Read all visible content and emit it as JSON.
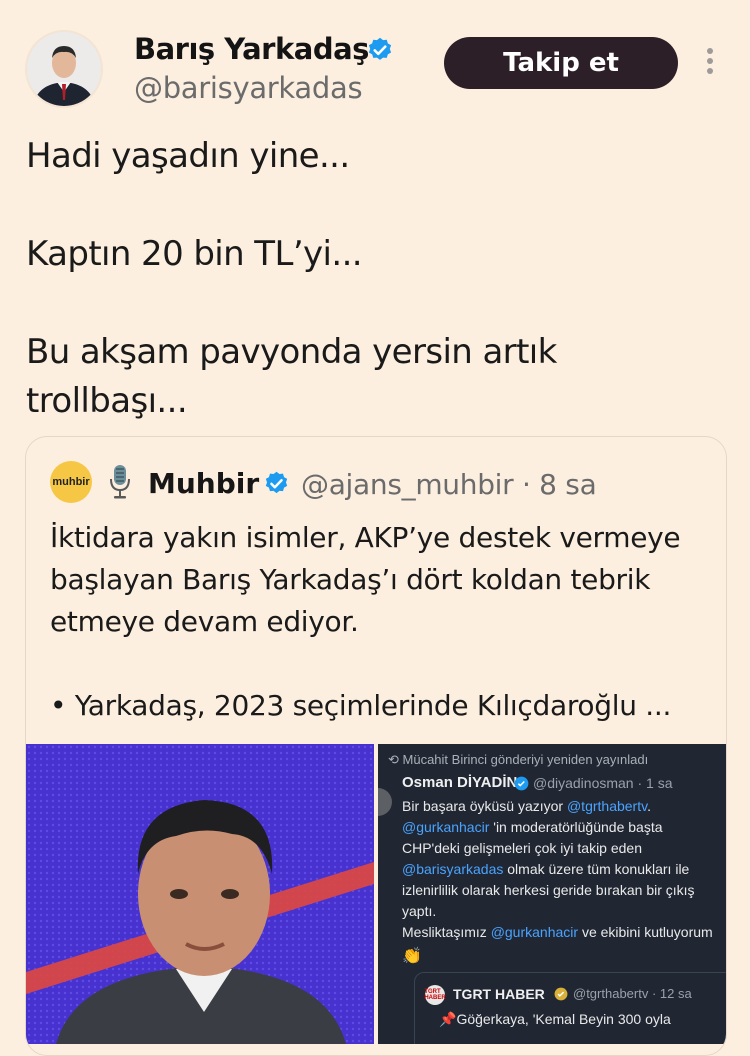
{
  "author": {
    "name": "Barış Yarkadaş",
    "handle": "@barisyarkadas",
    "verified": true
  },
  "follow_button": {
    "label": "Takip et"
  },
  "tweet": {
    "paragraphs": [
      "Hadi yaşadın yine...",
      "Kaptın 20 bin TL’yi...",
      "Bu akşam pavyonda yersin artık",
      "trollbaşı..."
    ]
  },
  "quote": {
    "logo_text": "muhbir",
    "name": "Muhbir",
    "handle_time": "@ajans_muhbir · 8 sa",
    "text_lines": [
      "İktidara yakın isimler, AKP’ye destek vermeye",
      "başlayan Barış Yarkadaş’ı dört koldan tebrik",
      "etmeye devam ediyor."
    ],
    "bullet": "• Yarkadaş, 2023 seçimlerinde Kılıçdaroğlu ..."
  },
  "embedded_screenshot": {
    "retweet_line": "Mücahit Birinci gönderiyi yeniden yayınladı",
    "name": "Osman DİYADİN",
    "handle_time": "@diyadinosman · 1 sa",
    "lines": [
      {
        "pre": "Bir başara öyküsü yazıyor ",
        "link": "@tgrthabertv",
        "post": "."
      },
      {
        "pre": "",
        "link": "@gurkanhacir",
        "post": " 'in moderatörlüğünde başta"
      },
      {
        "pre": "CHP'deki  gelişmeleri çok iyi takip eden",
        "link": "",
        "post": ""
      },
      {
        "pre": "",
        "link": "@barisyarkadas",
        "post": "  olmak üzere tüm konukları ile"
      },
      {
        "pre": "izlenirlilik olarak herkesi geride bırakan bir çıkış",
        "link": "",
        "post": ""
      },
      {
        "pre": "yaptı.",
        "link": "",
        "post": ""
      },
      {
        "pre": "Mesliktaşımız ",
        "link": "@gurkanhacir",
        "post": " ve ekibini kutluyorum"
      }
    ],
    "clap": "👏",
    "quoted_logo": "TGRT HABER",
    "quoted_name": "TGRT HABER",
    "quoted_handle_time": "@tgrthabertv · 12 sa",
    "quoted_body": "Göğerkaya, 'Kemal Beyin 300 oyla"
  },
  "colors": {
    "background": "#fcefe0",
    "verified_blue": "#1d9bf0",
    "button_bg": "#2c1f28"
  },
  "icons": [
    "verified-badge-icon",
    "more-options-icon",
    "microphone-icon",
    "retweet-icon"
  ]
}
